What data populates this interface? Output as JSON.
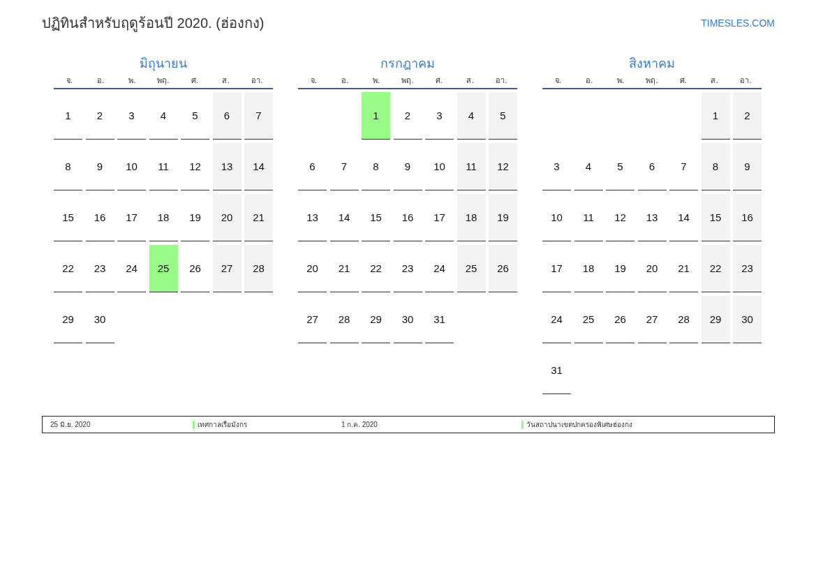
{
  "title": "ปฏิทินสำหรับฤดูร้อนปี 2020. (ฮ่องกง)",
  "site_link": "TIMESLES.COM",
  "months": [
    {
      "name": "มิถุนายน",
      "weekdays": [
        "จ.",
        "อ.",
        "พ.",
        "พฤ.",
        "ศ.",
        "ส.",
        "อา."
      ],
      "weeks": [
        [
          {
            "day": "1",
            "weekend": false,
            "holiday": false
          },
          {
            "day": "2",
            "weekend": false,
            "holiday": false
          },
          {
            "day": "3",
            "weekend": false,
            "holiday": false
          },
          {
            "day": "4",
            "weekend": false,
            "holiday": false
          },
          {
            "day": "5",
            "weekend": false,
            "holiday": false
          },
          {
            "day": "6",
            "weekend": true,
            "holiday": false
          },
          {
            "day": "7",
            "weekend": true,
            "holiday": false
          }
        ],
        [
          {
            "day": "8",
            "weekend": false,
            "holiday": false
          },
          {
            "day": "9",
            "weekend": false,
            "holiday": false
          },
          {
            "day": "10",
            "weekend": false,
            "holiday": false
          },
          {
            "day": "11",
            "weekend": false,
            "holiday": false
          },
          {
            "day": "12",
            "weekend": false,
            "holiday": false
          },
          {
            "day": "13",
            "weekend": true,
            "holiday": false
          },
          {
            "day": "14",
            "weekend": true,
            "holiday": false
          }
        ],
        [
          {
            "day": "15",
            "weekend": false,
            "holiday": false
          },
          {
            "day": "16",
            "weekend": false,
            "holiday": false
          },
          {
            "day": "17",
            "weekend": false,
            "holiday": false
          },
          {
            "day": "18",
            "weekend": false,
            "holiday": false
          },
          {
            "day": "19",
            "weekend": false,
            "holiday": false
          },
          {
            "day": "20",
            "weekend": true,
            "holiday": false
          },
          {
            "day": "21",
            "weekend": true,
            "holiday": false
          }
        ],
        [
          {
            "day": "22",
            "weekend": false,
            "holiday": false
          },
          {
            "day": "23",
            "weekend": false,
            "holiday": false
          },
          {
            "day": "24",
            "weekend": false,
            "holiday": false
          },
          {
            "day": "25",
            "weekend": false,
            "holiday": true
          },
          {
            "day": "26",
            "weekend": false,
            "holiday": false
          },
          {
            "day": "27",
            "weekend": true,
            "holiday": false
          },
          {
            "day": "28",
            "weekend": true,
            "holiday": false
          }
        ],
        [
          {
            "day": "29",
            "weekend": false,
            "holiday": false
          },
          {
            "day": "30",
            "weekend": false,
            "holiday": false
          },
          {
            "kind": "empty"
          },
          {
            "kind": "empty"
          },
          {
            "kind": "empty"
          },
          {
            "kind": "empty"
          },
          {
            "kind": "empty"
          }
        ]
      ]
    },
    {
      "name": "กรกฎาคม",
      "weekdays": [
        "จ.",
        "อ.",
        "พ.",
        "พฤ.",
        "ศ.",
        "ส.",
        "อา."
      ],
      "weeks": [
        [
          {
            "kind": "empty"
          },
          {
            "kind": "empty"
          },
          {
            "day": "1",
            "weekend": false,
            "holiday": true
          },
          {
            "day": "2",
            "weekend": false,
            "holiday": false
          },
          {
            "day": "3",
            "weekend": false,
            "holiday": false
          },
          {
            "day": "4",
            "weekend": true,
            "holiday": false
          },
          {
            "day": "5",
            "weekend": true,
            "holiday": false
          }
        ],
        [
          {
            "day": "6",
            "weekend": false,
            "holiday": false
          },
          {
            "day": "7",
            "weekend": false,
            "holiday": false
          },
          {
            "day": "8",
            "weekend": false,
            "holiday": false
          },
          {
            "day": "9",
            "weekend": false,
            "holiday": false
          },
          {
            "day": "10",
            "weekend": false,
            "holiday": false
          },
          {
            "day": "11",
            "weekend": true,
            "holiday": false
          },
          {
            "day": "12",
            "weekend": true,
            "holiday": false
          }
        ],
        [
          {
            "day": "13",
            "weekend": false,
            "holiday": false
          },
          {
            "day": "14",
            "weekend": false,
            "holiday": false
          },
          {
            "day": "15",
            "weekend": false,
            "holiday": false
          },
          {
            "day": "16",
            "weekend": false,
            "holiday": false
          },
          {
            "day": "17",
            "weekend": false,
            "holiday": false
          },
          {
            "day": "18",
            "weekend": true,
            "holiday": false
          },
          {
            "day": "19",
            "weekend": true,
            "holiday": false
          }
        ],
        [
          {
            "day": "20",
            "weekend": false,
            "holiday": false
          },
          {
            "day": "21",
            "weekend": false,
            "holiday": false
          },
          {
            "day": "22",
            "weekend": false,
            "holiday": false
          },
          {
            "day": "23",
            "weekend": false,
            "holiday": false
          },
          {
            "day": "24",
            "weekend": false,
            "holiday": false
          },
          {
            "day": "25",
            "weekend": true,
            "holiday": false
          },
          {
            "day": "26",
            "weekend": true,
            "holiday": false
          }
        ],
        [
          {
            "day": "27",
            "weekend": false,
            "holiday": false
          },
          {
            "day": "28",
            "weekend": false,
            "holiday": false
          },
          {
            "day": "29",
            "weekend": false,
            "holiday": false
          },
          {
            "day": "30",
            "weekend": false,
            "holiday": false
          },
          {
            "day": "31",
            "weekend": false,
            "holiday": false
          },
          {
            "kind": "empty"
          },
          {
            "kind": "empty"
          }
        ]
      ]
    },
    {
      "name": "สิงหาคม",
      "weekdays": [
        "จ.",
        "อ.",
        "พ.",
        "พฤ.",
        "ศ.",
        "ส.",
        "อา."
      ],
      "weeks": [
        [
          {
            "kind": "empty"
          },
          {
            "kind": "empty"
          },
          {
            "kind": "empty"
          },
          {
            "kind": "empty"
          },
          {
            "kind": "empty"
          },
          {
            "day": "1",
            "weekend": true,
            "holiday": false
          },
          {
            "day": "2",
            "weekend": true,
            "holiday": false
          }
        ],
        [
          {
            "day": "3",
            "weekend": false,
            "holiday": false
          },
          {
            "day": "4",
            "weekend": false,
            "holiday": false
          },
          {
            "day": "5",
            "weekend": false,
            "holiday": false
          },
          {
            "day": "6",
            "weekend": false,
            "holiday": false
          },
          {
            "day": "7",
            "weekend": false,
            "holiday": false
          },
          {
            "day": "8",
            "weekend": true,
            "holiday": false
          },
          {
            "day": "9",
            "weekend": true,
            "holiday": false
          }
        ],
        [
          {
            "day": "10",
            "weekend": false,
            "holiday": false
          },
          {
            "day": "11",
            "weekend": false,
            "holiday": false
          },
          {
            "day": "12",
            "weekend": false,
            "holiday": false
          },
          {
            "day": "13",
            "weekend": false,
            "holiday": false
          },
          {
            "day": "14",
            "weekend": false,
            "holiday": false
          },
          {
            "day": "15",
            "weekend": true,
            "holiday": false
          },
          {
            "day": "16",
            "weekend": true,
            "holiday": false
          }
        ],
        [
          {
            "day": "17",
            "weekend": false,
            "holiday": false
          },
          {
            "day": "18",
            "weekend": false,
            "holiday": false
          },
          {
            "day": "19",
            "weekend": false,
            "holiday": false
          },
          {
            "day": "20",
            "weekend": false,
            "holiday": false
          },
          {
            "day": "21",
            "weekend": false,
            "holiday": false
          },
          {
            "day": "22",
            "weekend": true,
            "holiday": false
          },
          {
            "day": "23",
            "weekend": true,
            "holiday": false
          }
        ],
        [
          {
            "day": "24",
            "weekend": false,
            "holiday": false
          },
          {
            "day": "25",
            "weekend": false,
            "holiday": false
          },
          {
            "day": "26",
            "weekend": false,
            "holiday": false
          },
          {
            "day": "27",
            "weekend": false,
            "holiday": false
          },
          {
            "day": "28",
            "weekend": false,
            "holiday": false
          },
          {
            "day": "29",
            "weekend": true,
            "holiday": false
          },
          {
            "day": "30",
            "weekend": true,
            "holiday": false
          }
        ],
        [
          {
            "day": "31",
            "weekend": false,
            "holiday": false
          },
          {
            "kind": "empty"
          },
          {
            "kind": "empty"
          },
          {
            "kind": "empty"
          },
          {
            "kind": "empty"
          },
          {
            "kind": "empty"
          },
          {
            "kind": "empty"
          }
        ]
      ]
    }
  ],
  "holidays": [
    {
      "date": "25 มิ.ย. 2020",
      "name": "เทศกาลเรือมังกร"
    },
    {
      "date": "1 ก.ค. 2020",
      "name": "วันสถาปนาเขตปกครองพิเศษฮ่องกง"
    }
  ]
}
